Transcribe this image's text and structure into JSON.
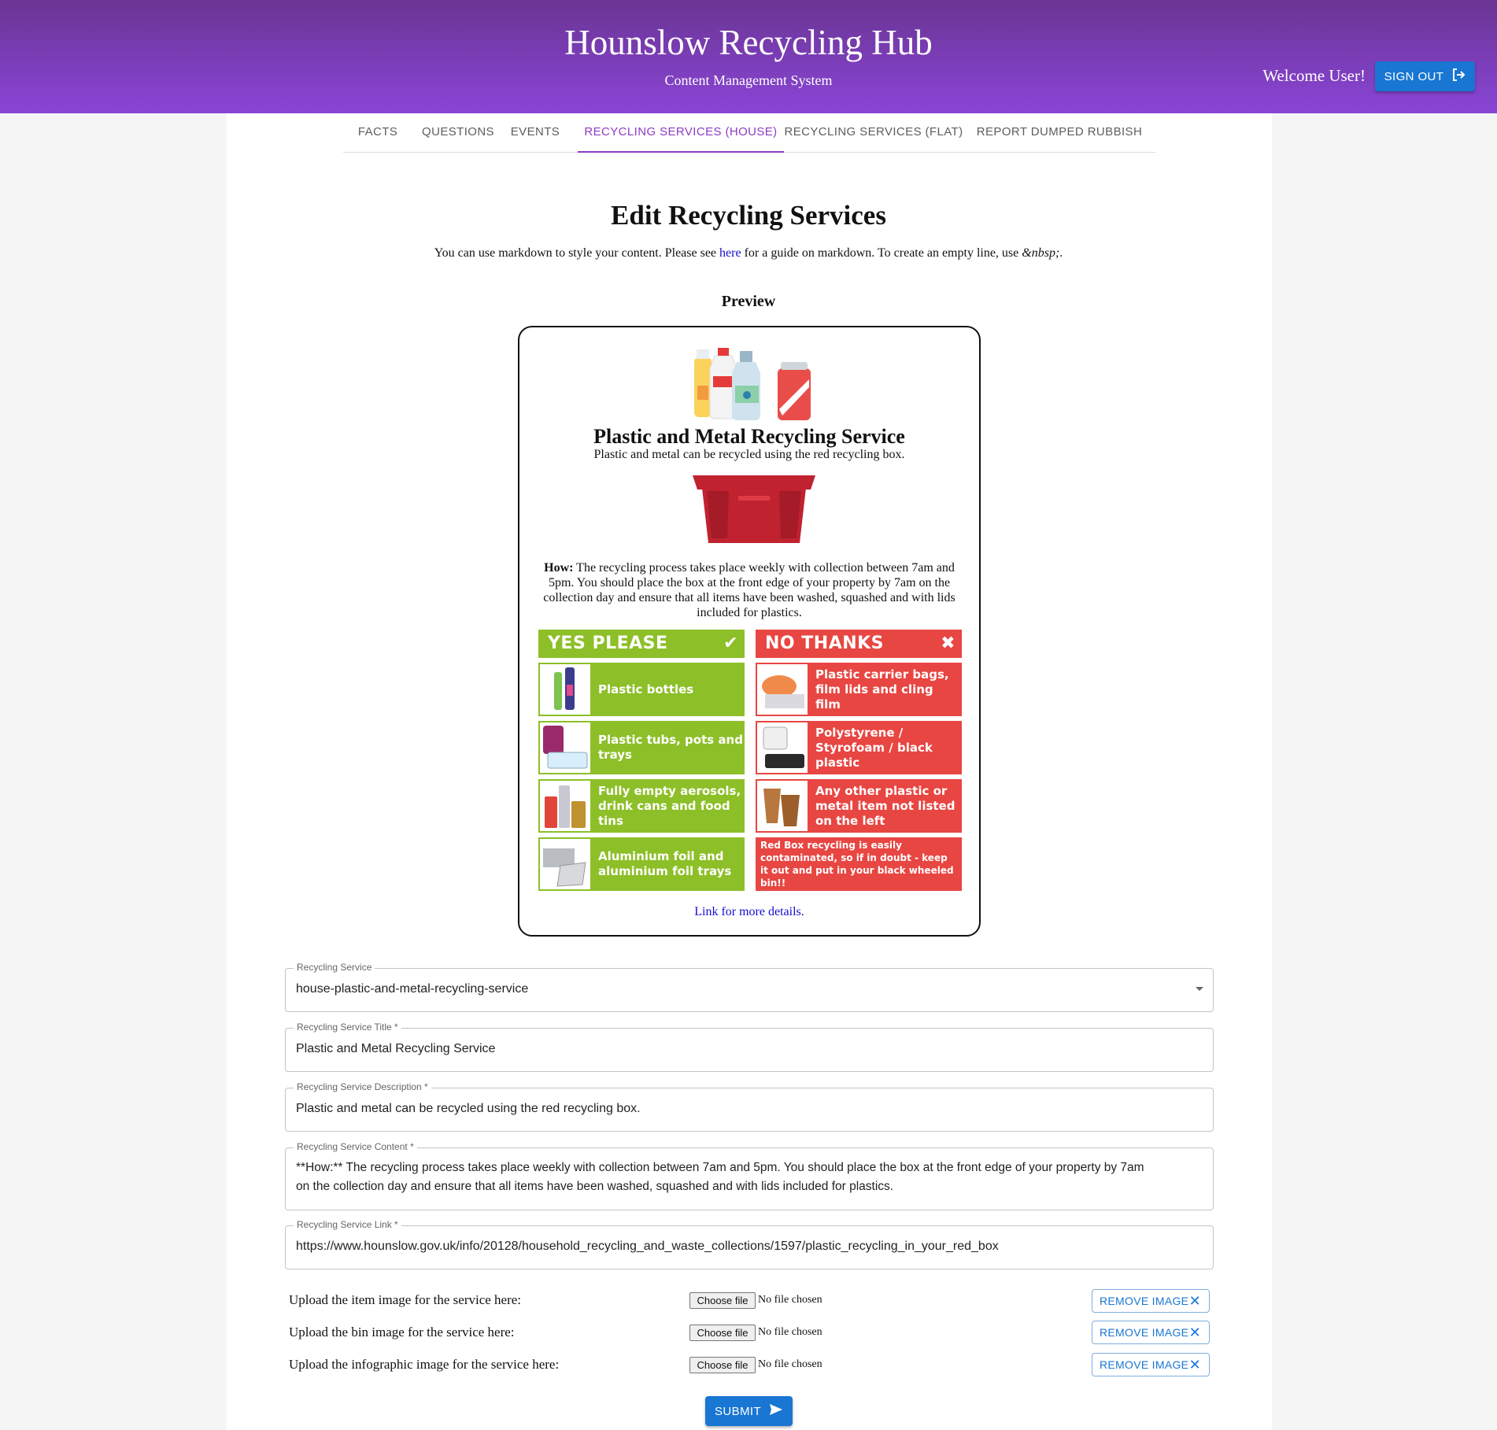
{
  "header": {
    "title": "Hounslow Recycling Hub",
    "subtitle": "Content Management System",
    "welcome": "Welcome User!",
    "signout_label": "SIGN OUT"
  },
  "tabs": [
    {
      "label": "FACTS"
    },
    {
      "label": "QUESTIONS"
    },
    {
      "label": "EVENTS"
    },
    {
      "label": "RECYCLING SERVICES (HOUSE)",
      "active": true
    },
    {
      "label": "RECYCLING SERVICES (FLAT)"
    },
    {
      "label": "REPORT DUMPED RUBBISH"
    }
  ],
  "page": {
    "title": "Edit Recycling Services",
    "note_before": "You can use markdown to style your content. Please see ",
    "note_link": "here",
    "note_after": " for a guide on markdown. To create an empty line, use ",
    "note_code": "&nbsp;",
    "note_end": ".",
    "preview_heading": "Preview"
  },
  "preview": {
    "title": "Plastic and Metal Recycling Service",
    "description": "Plastic and metal can be recycled using the red recycling box.",
    "how_label": "How:",
    "how_text": " The recycling process takes place weekly with collection between 7am and 5pm. You should place the box at the front edge of your property by 7am on the collection day and ensure that all items have been washed, squashed and with lids included for plastics.",
    "link_text": "Link for more details.",
    "infographic": {
      "yes_header": "YES PLEASE",
      "no_header": "NO THANKS",
      "yes_items": [
        "Plastic bottles",
        "Plastic tubs, pots and trays",
        "Fully empty aerosols, drink cans and food tins",
        "Aluminium foil and aluminium foil trays"
      ],
      "no_items": [
        "Plastic carrier bags, film lids and cling film",
        "Polystyrene / Styrofoam / black plastic",
        "Any other plastic or metal item not listed on the left"
      ],
      "no_warning": "Red Box recycling is easily contaminated, so if in doubt - keep it out and put in your black wheeled bin!!"
    }
  },
  "form": {
    "service": {
      "label": "Recycling Service",
      "value": "house-plastic-and-metal-recycling-service"
    },
    "title": {
      "label": "Recycling Service Title *",
      "value": "Plastic and Metal Recycling Service"
    },
    "description": {
      "label": "Recycling Service Description *",
      "value": "Plastic and metal can be recycled using the red recycling box."
    },
    "content": {
      "label": "Recycling Service Content *",
      "line1": "**How:** The recycling process takes place weekly with collection between 7am and 5pm. You should place the box at the front edge of your property by 7am",
      "line2": "on the collection day and ensure that all items have been washed, squashed and with lids included for plastics."
    },
    "link": {
      "label": "Recycling Service Link *",
      "value": "https://www.hounslow.gov.uk/info/20128/household_recycling_and_waste_collections/1597/plastic_recycling_in_your_red_box"
    },
    "uploads": [
      {
        "label": "Upload the item image for the service here:",
        "choose": "Choose file",
        "status": "No file chosen",
        "remove": "REMOVE IMAGE"
      },
      {
        "label": "Upload the bin image for the service here:",
        "choose": "Choose file",
        "status": "No file chosen",
        "remove": "REMOVE IMAGE"
      },
      {
        "label": "Upload the infographic image for the service here:",
        "choose": "Choose file",
        "status": "No file chosen",
        "remove": "REMOVE IMAGE"
      }
    ],
    "submit_label": "SUBMIT"
  },
  "colors": {
    "header_top": "#6a3594",
    "header_bottom": "#8a45d6",
    "accent_tab": "#8e3bc4",
    "button": "#1976d2",
    "yes_green": "#8dbf28",
    "no_red": "#e84642",
    "bin_red": "#c0222f"
  }
}
